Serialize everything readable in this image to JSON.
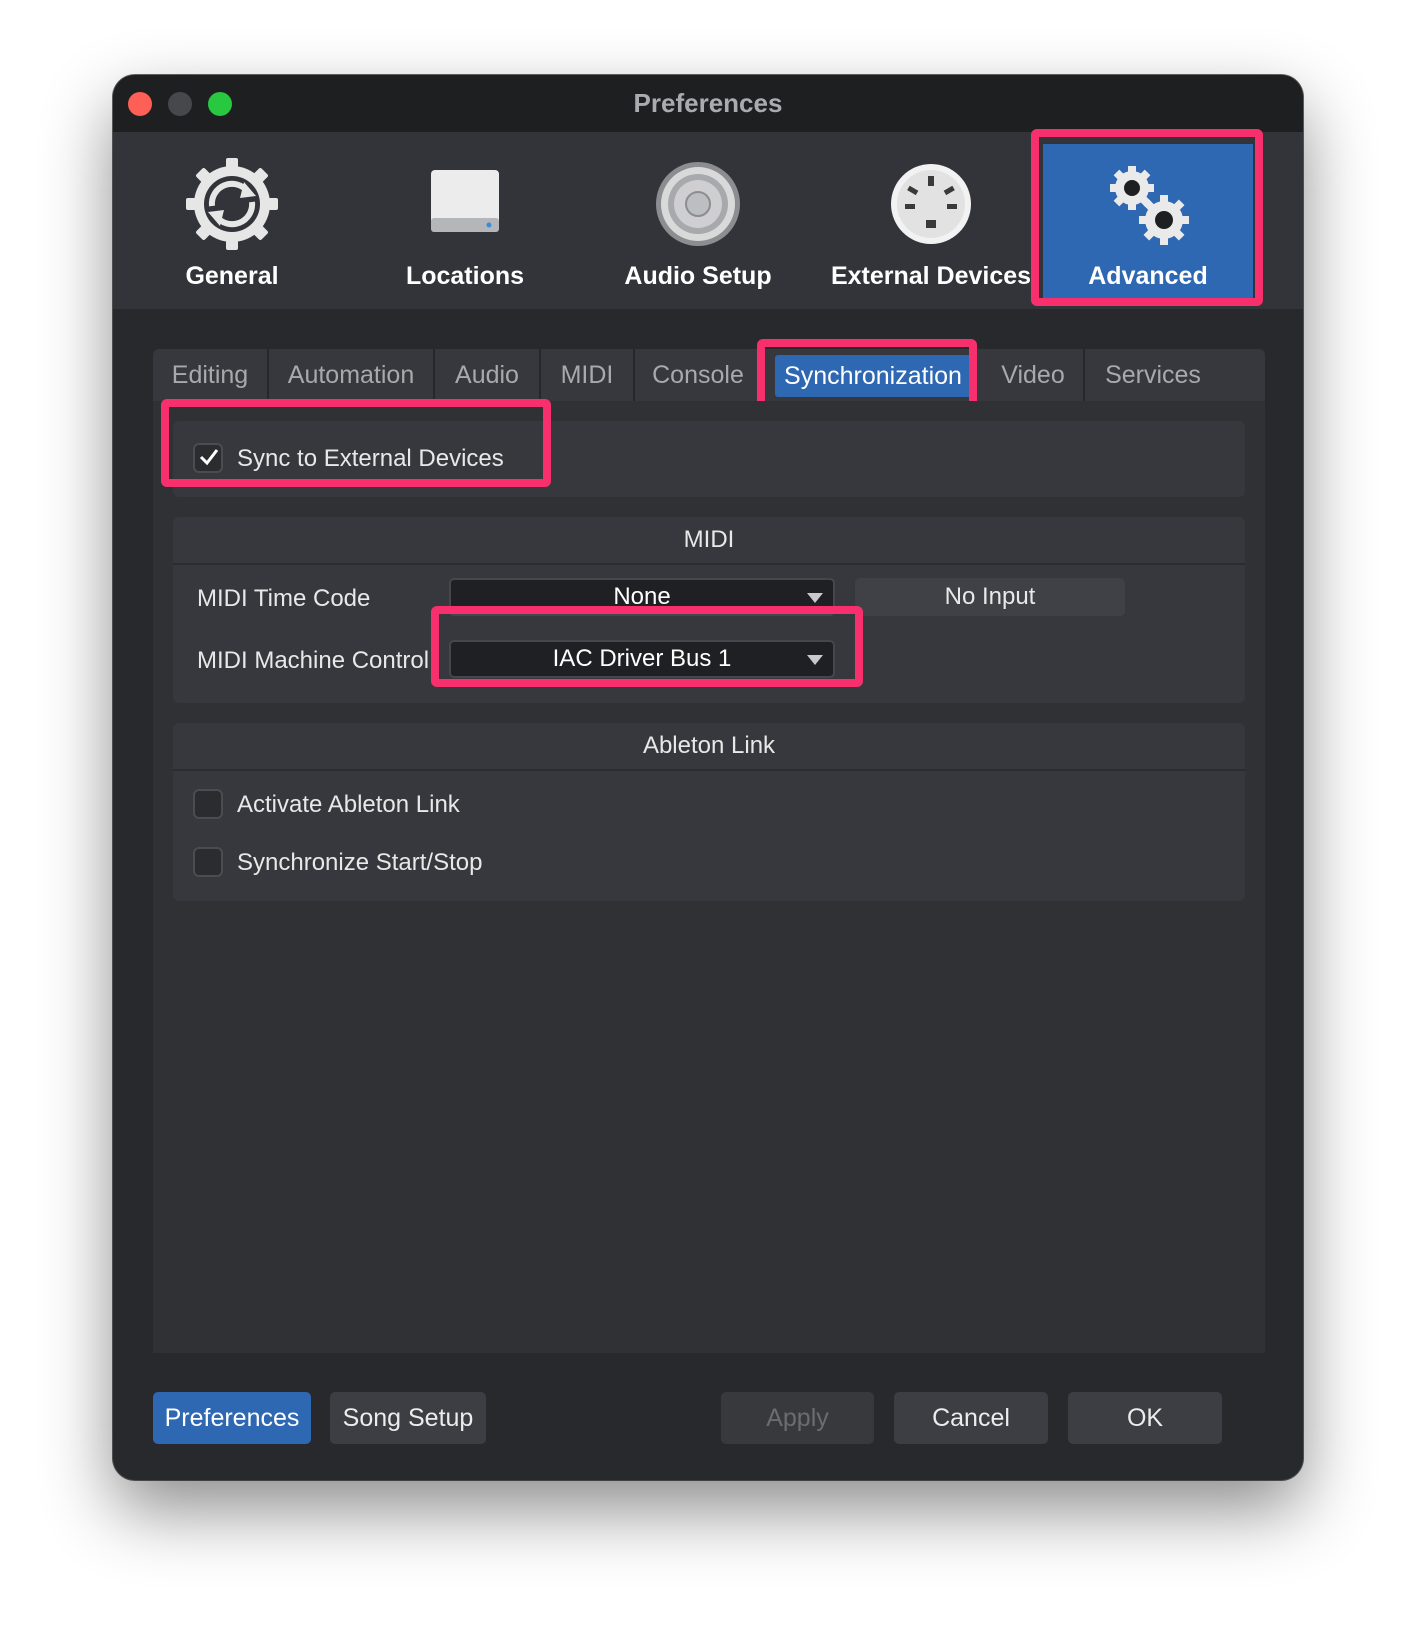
{
  "window": {
    "title": "Preferences"
  },
  "toolbar": {
    "items": [
      {
        "label": "General",
        "icon": "general-gear-sync-icon",
        "active": false
      },
      {
        "label": "Locations",
        "icon": "drive-icon",
        "active": false
      },
      {
        "label": "Audio Setup",
        "icon": "speaker-icon",
        "active": false
      },
      {
        "label": "External Devices",
        "icon": "midi-port-icon",
        "active": false
      },
      {
        "label": "Advanced",
        "icon": "gears-icon",
        "active": true
      }
    ]
  },
  "tabs": [
    {
      "label": "Editing",
      "active": false
    },
    {
      "label": "Automation",
      "active": false
    },
    {
      "label": "Audio",
      "active": false
    },
    {
      "label": "MIDI",
      "active": false
    },
    {
      "label": "Console",
      "active": false
    },
    {
      "label": "Synchronization",
      "active": true
    },
    {
      "label": "Video",
      "active": false
    },
    {
      "label": "Services",
      "active": false
    }
  ],
  "sync": {
    "label": "Sync to External Devices",
    "checked": true
  },
  "midi_section": {
    "title": "MIDI",
    "time_code": {
      "label": "MIDI Time Code",
      "value": "None",
      "status": "No Input"
    },
    "machine_control": {
      "label": "MIDI Machine Control",
      "value": "IAC Driver Bus 1"
    }
  },
  "ableton_section": {
    "title": "Ableton Link",
    "activate": {
      "label": "Activate Ableton Link",
      "checked": false
    },
    "start_stop": {
      "label": "Synchronize Start/Stop",
      "checked": false
    }
  },
  "footer": {
    "preferences": "Preferences",
    "song_setup": "Song Setup",
    "apply": "Apply",
    "cancel": "Cancel",
    "ok": "OK"
  },
  "colors": {
    "accent": "#2e67b2",
    "highlight": "#f7306d"
  }
}
